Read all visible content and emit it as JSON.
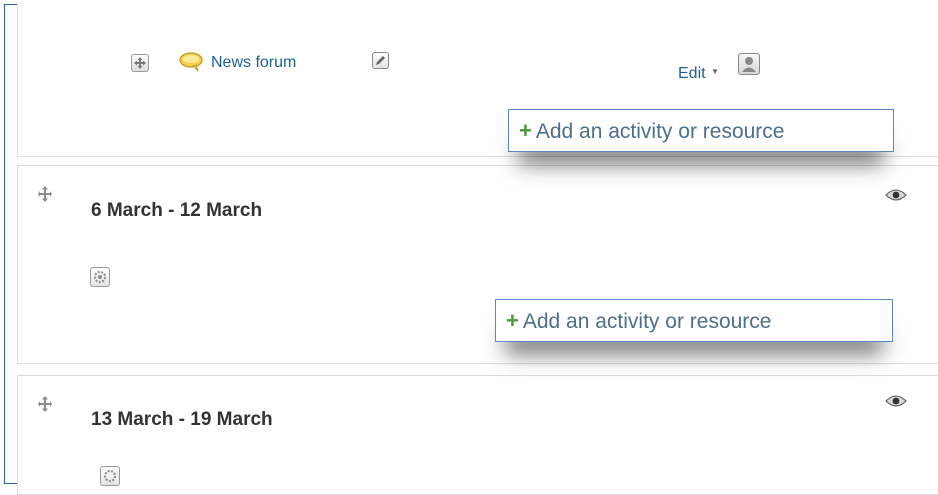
{
  "top_activity": {
    "name": "News forum",
    "edit_label": "Edit"
  },
  "add_activity_label": "Add an activity or resource",
  "sections": [
    {
      "title": "6 March - 12 March"
    },
    {
      "title": "13 March - 19 March"
    }
  ],
  "colors": {
    "link": "#1d5f8f",
    "plus": "#4a9a3a",
    "frame": "#2f5f9f"
  }
}
